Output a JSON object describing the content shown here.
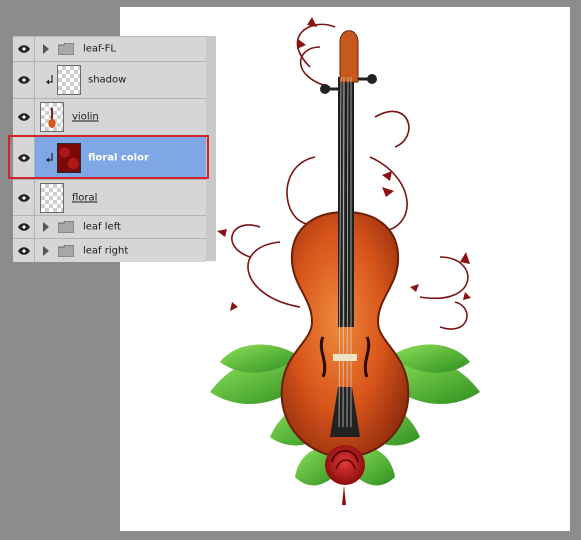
{
  "layers_panel": {
    "layers": [
      {
        "name": "leaf-FL",
        "kind": "group"
      },
      {
        "name": "shadow",
        "kind": "clipped"
      },
      {
        "name": "violin",
        "kind": "layer"
      },
      {
        "name": "floral color",
        "kind": "clipped",
        "selected": true
      },
      {
        "name": "floral",
        "kind": "layer"
      },
      {
        "name": "leaf left",
        "kind": "group"
      },
      {
        "name": "leaf right",
        "kind": "group"
      }
    ]
  },
  "colors": {
    "selection_highlight": "#7fa7e6",
    "annotation_box": "#d2232a",
    "canvas_background": "#8c8c8c"
  },
  "icons": {
    "visibility": "eye-icon",
    "group": "folder-icon",
    "expand": "triangle-right-icon",
    "clipping": "clipping-arrow-icon"
  }
}
